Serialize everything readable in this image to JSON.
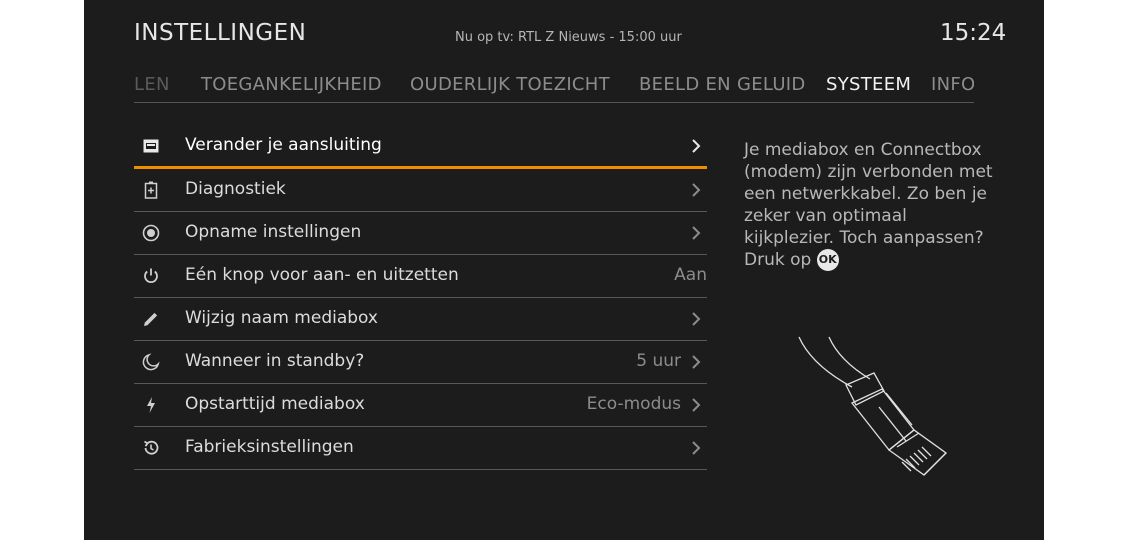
{
  "header": {
    "title": "INSTELLINGEN",
    "now_on_tv": "Nu op tv: RTL Z Nieuws - 15:00 uur",
    "clock": "15:24"
  },
  "tabs": [
    {
      "label": "LEN"
    },
    {
      "label": "TOEGANKELIJKHEID"
    },
    {
      "label": "OUDERLIJK TOEZICHT"
    },
    {
      "label": "BEELD EN GELUID"
    },
    {
      "label": "SYSTEEM"
    },
    {
      "label": "INFO"
    }
  ],
  "menu": {
    "items": [
      {
        "label": "Verander je aansluiting",
        "icon": "ethernet-port-icon",
        "value": ""
      },
      {
        "label": "Diagnostiek",
        "icon": "battery-plus-icon",
        "value": ""
      },
      {
        "label": "Opname instellingen",
        "icon": "record-icon",
        "value": ""
      },
      {
        "label": "Eén knop voor aan- en uitzetten",
        "icon": "power-icon",
        "value": "Aan"
      },
      {
        "label": "Wijzig naam mediabox",
        "icon": "pencil-icon",
        "value": ""
      },
      {
        "label": "Wanneer in standby?",
        "icon": "moon-icon",
        "value": "5 uur"
      },
      {
        "label": "Opstarttijd mediabox",
        "icon": "lightning-icon",
        "value": "Eco-modus"
      },
      {
        "label": "Fabrieksinstellingen",
        "icon": "reset-icon",
        "value": ""
      }
    ]
  },
  "info": {
    "text": "Je mediabox en Connectbox (modem) zijn verbonden met een netwerkkabel. Zo ben je zeker van optimaal kijkplezier. Toch aanpassen? Druk op",
    "ok_label": "OK"
  },
  "colors": {
    "background": "#1c1c1c",
    "accent": "#f08c00",
    "divider": "#585858"
  }
}
